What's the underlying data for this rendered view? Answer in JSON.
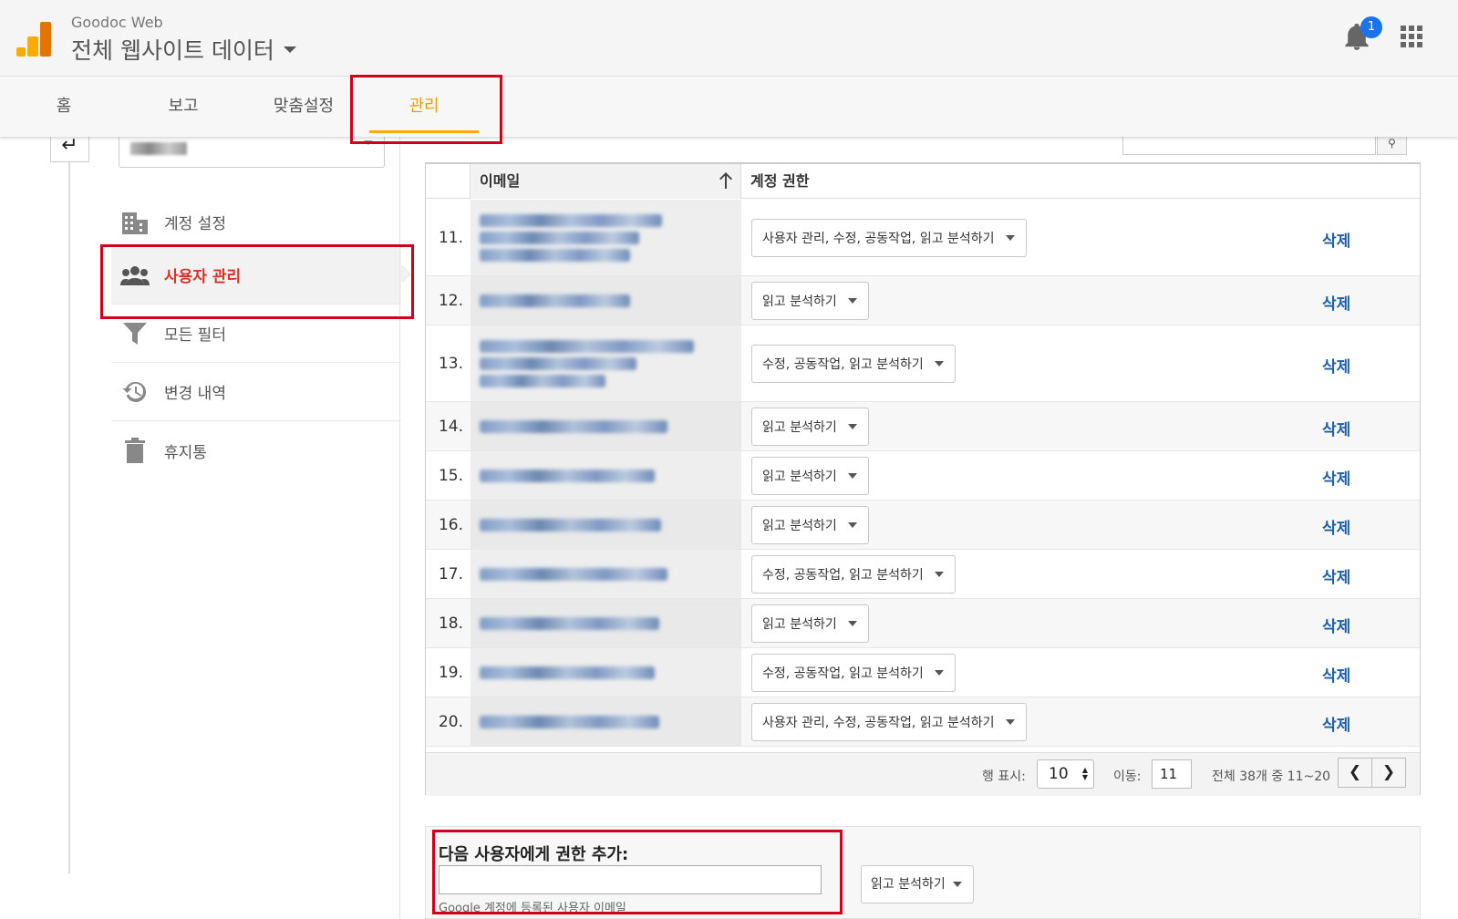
{
  "header": {
    "account_name": "Goodoc Web",
    "property_name": "전체 웹사이트 데이터",
    "notification_count": "1"
  },
  "nav": {
    "tabs": [
      {
        "label": "홈"
      },
      {
        "label": "보고"
      },
      {
        "label": "맞춤설정"
      },
      {
        "label": "관리"
      }
    ],
    "active_tab": "관리"
  },
  "sidebar": {
    "items": [
      {
        "label": "계정 설정",
        "icon": "building-icon"
      },
      {
        "label": "사용자 관리",
        "icon": "users-icon"
      },
      {
        "label": "모든 필터",
        "icon": "filter-icon"
      },
      {
        "label": "변경 내역",
        "icon": "history-icon"
      },
      {
        "label": "휴지통",
        "icon": "trash-icon"
      }
    ],
    "active_item": "사용자 관리"
  },
  "table": {
    "columns": {
      "email": "이메일",
      "permissions": "계정 권한"
    },
    "delete_label": "삭제",
    "rows": [
      {
        "num": "11.",
        "permission": "사용자 관리, 수정, 공동작업, 읽고 분석하기"
      },
      {
        "num": "12.",
        "permission": "읽고 분석하기"
      },
      {
        "num": "13.",
        "permission": "수정, 공동작업, 읽고 분석하기"
      },
      {
        "num": "14.",
        "permission": "읽고 분석하기"
      },
      {
        "num": "15.",
        "permission": "읽고 분석하기"
      },
      {
        "num": "16.",
        "permission": "읽고 분석하기"
      },
      {
        "num": "17.",
        "permission": "수정, 공동작업, 읽고 분석하기"
      },
      {
        "num": "18.",
        "permission": "읽고 분석하기"
      },
      {
        "num": "19.",
        "permission": "수정, 공동작업, 읽고 분석하기"
      },
      {
        "num": "20.",
        "permission": "사용자 관리, 수정, 공동작업, 읽고 분석하기"
      }
    ]
  },
  "pager": {
    "rows_label": "행 표시:",
    "rows_value": "10",
    "goto_label": "이동:",
    "goto_value": "11",
    "range_text": "전체 38개 중 11~20"
  },
  "add_user": {
    "title": "다음 사용자에게 권한 추가:",
    "hint": "Google 계정에 등록된 사용자 이메일",
    "permission": "읽고 분석하기"
  },
  "colors": {
    "accent": "#f9ab00",
    "highlight_box": "#d0021b",
    "link": "#1a5fa8",
    "active_sidebar": "#d93025"
  }
}
